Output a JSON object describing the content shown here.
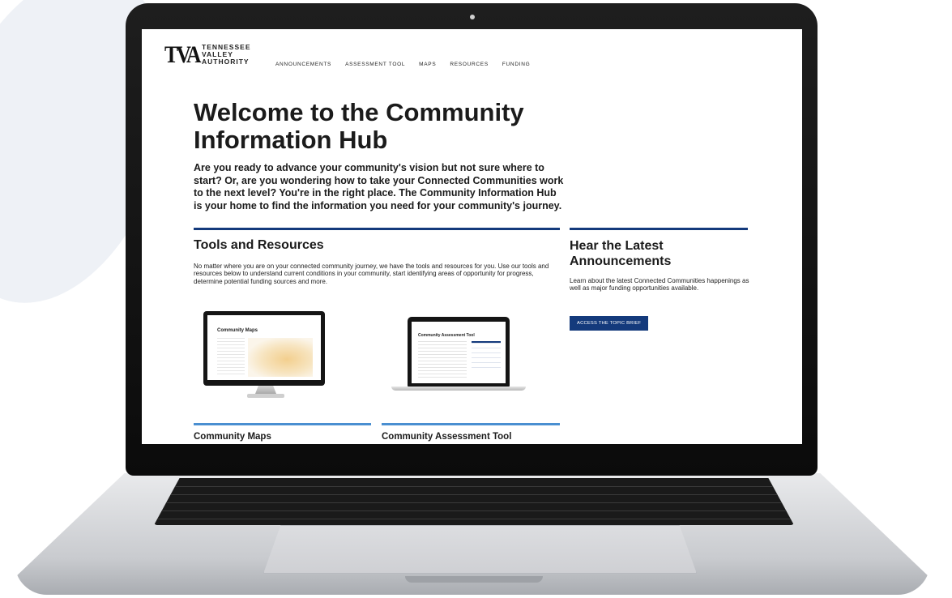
{
  "brand": {
    "logo_mark": "TVA",
    "logo_lines": [
      "TENNESSEE",
      "VALLEY",
      "AUTHORITY"
    ]
  },
  "nav": {
    "items": [
      "ANNOUNCEMENTS",
      "ASSESSMENT TOOL",
      "MAPS",
      "RESOURCES",
      "FUNDING"
    ]
  },
  "hero": {
    "title": "Welcome to the Community Information Hub",
    "intro": "Are you ready to advance your community's vision but not sure where to start? Or, are you wondering how to take your Connected Communities work to the next level? You're in the right place. The Community Information Hub is your home to find the information you need for your community's journey."
  },
  "tools": {
    "title": "Tools and Resources",
    "description": "No matter where you are on your connected community journey, we have the tools and resources for you. Use our tools and resources below to understand current conditions in your community, start identifying areas of opportunity for progress, determine potential funding sources and more.",
    "cards": [
      {
        "title": "Community Maps",
        "preview_title": "Community Maps"
      },
      {
        "title": "Community Assessment Tool",
        "preview_title": "Community Assessment Tool"
      }
    ]
  },
  "announcements": {
    "title": "Hear the Latest Announcements",
    "description": "Learn about the latest Connected Communities happenings as well as major funding opportunities available.",
    "button_label": "ACCESS THE TOPIC BRIEF"
  },
  "colors": {
    "brand_navy": "#143a7c",
    "card_accent": "#4a8fd1"
  }
}
